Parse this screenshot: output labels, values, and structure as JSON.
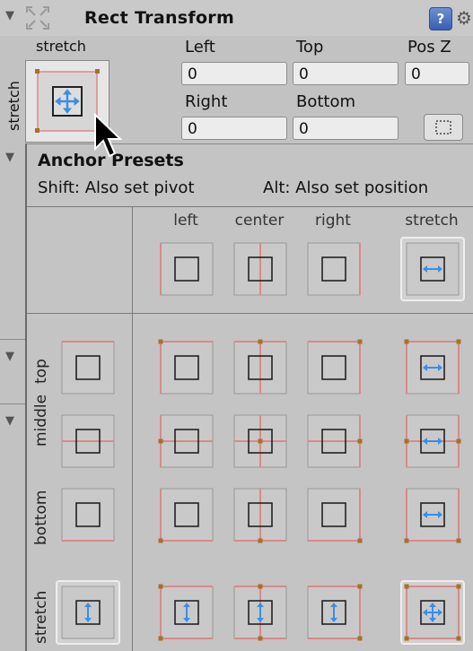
{
  "component": {
    "title": "Rect Transform",
    "help_icon": "?",
    "fold_icon": "triangle-down",
    "settings_icon": "gear"
  },
  "anchor": {
    "horizontal_label": "stretch",
    "vertical_label": "stretch"
  },
  "fields": {
    "left": {
      "label": "Left",
      "value": "0"
    },
    "top": {
      "label": "Top",
      "value": "0"
    },
    "posz": {
      "label": "Pos Z",
      "value": "0"
    },
    "right": {
      "label": "Right",
      "value": "0"
    },
    "bottom": {
      "label": "Bottom",
      "value": "0"
    }
  },
  "popup": {
    "title": "Anchor Presets",
    "shift_hint": "Shift: Also set pivot",
    "alt_hint": "Alt: Also set position",
    "columns": [
      "left",
      "center",
      "right",
      "stretch"
    ],
    "rows": [
      "top",
      "middle",
      "bottom",
      "stretch"
    ]
  },
  "colors": {
    "anchor_line": "#d88a8a",
    "anchor_dot": "#a8702a",
    "arrow_blue": "#3a8ee6",
    "selected_border": "#eeeeee"
  }
}
